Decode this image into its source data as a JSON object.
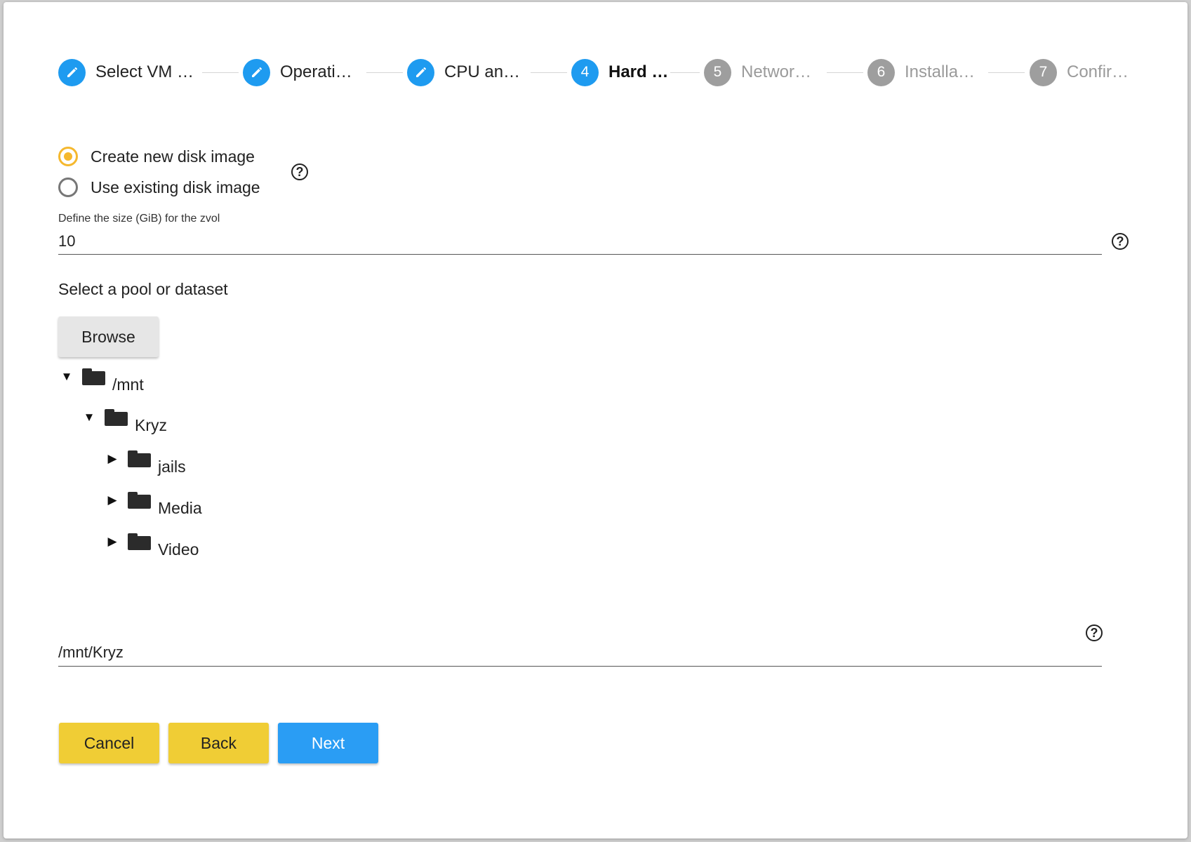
{
  "stepper": {
    "steps": [
      {
        "number": "1",
        "label": "Select VM …",
        "state": "done",
        "icon": "pencil-icon"
      },
      {
        "number": "2",
        "label": "Operati…",
        "state": "done",
        "icon": "pencil-icon"
      },
      {
        "number": "3",
        "label": "CPU an…",
        "state": "done",
        "icon": "pencil-icon"
      },
      {
        "number": "4",
        "label": "Hard …",
        "state": "active"
      },
      {
        "number": "5",
        "label": "Networ…",
        "state": "todo"
      },
      {
        "number": "6",
        "label": "Installa…",
        "state": "todo"
      },
      {
        "number": "7",
        "label": "Confir…",
        "state": "todo"
      }
    ]
  },
  "disk_options": {
    "create_label": "Create new disk image",
    "use_existing_label": "Use existing disk image",
    "selected": "create"
  },
  "size_field": {
    "label": "Define the size (GiB) for the zvol",
    "value": "10"
  },
  "pool": {
    "label": "Select a pool or dataset",
    "browse_label": "Browse",
    "tree": [
      {
        "label": "/mnt",
        "expanded": true
      },
      {
        "label": "Kryz",
        "expanded": true
      },
      {
        "label": "jails",
        "expanded": false
      },
      {
        "label": "Media",
        "expanded": false
      },
      {
        "label": "Video",
        "expanded": false
      }
    ],
    "path_value": "/mnt/Kryz"
  },
  "actions": {
    "cancel_label": "Cancel",
    "back_label": "Back",
    "next_label": "Next"
  },
  "colors": {
    "step_active": "#1e9bf0",
    "step_todo": "#9e9e9e",
    "radio_checked": "#f5b82e",
    "button_yellow": "#f0cd35",
    "button_blue": "#2a9df4"
  },
  "help_glyph": "?"
}
